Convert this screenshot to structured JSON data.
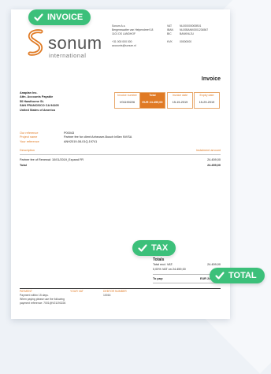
{
  "badges": {
    "invoice": "INVOICE",
    "tax": "TAX",
    "total": "TOTAL"
  },
  "company": {
    "logo_word": "sonum",
    "logo_sub": "international",
    "address_lines": [
      "Sonum A.s.",
      "Bergenswatter van Helpendreef 18",
      "1101 DS LANDHOF",
      "",
      "+31 000 000 000",
      "accounts@sonum.nl"
    ],
    "id_labels": [
      "VAT",
      "IBAN",
      "BIC",
      "",
      "KVK"
    ],
    "id_values": [
      "NL000000000B01",
      "NL00BANK0001234567",
      "BANKNL2U",
      "",
      "00000000"
    ]
  },
  "doc_title": "Invoice",
  "meta": [
    {
      "label": "Invoice number",
      "value": "V01190226"
    },
    {
      "label": "Total",
      "value": "EUR 24.459,00"
    },
    {
      "label": "Invoice date",
      "value": "15-15-2019"
    },
    {
      "label": "Expiry date",
      "value": "15-29-2019"
    }
  ],
  "bill_to": {
    "company": "Anaplan Inc.",
    "lines": [
      "Attn. Accounts Payable",
      "50 Hawthorne St.",
      "SAN FRANCISCO CA 94105",
      "United States of America"
    ]
  },
  "refs": [
    {
      "label": "Our reference",
      "value": "P00043"
    },
    {
      "label": "Project name",
      "value": "Partner fee for client Anheuser-Busch InBev NV/SA"
    },
    {
      "label": "Your reference",
      "value": "ANH2019-08-01Q-19741"
    }
  ],
  "lines_header": {
    "description": "Description",
    "amount": "Instalment amount"
  },
  "lines": [
    {
      "description": "Partner fee of Renewal: 10/01/2019_Expand FR",
      "amount": "24.459,00"
    }
  ],
  "total_row": {
    "label": "Total",
    "amount": "24.459,00"
  },
  "totals": {
    "title": "Totals",
    "excl_label": "Total excl. VAT:",
    "excl_value": "24.459,00",
    "vat_label": "0,00% VAT on 24.459,00",
    "vat_value": "0,00",
    "pay_label": "To pay:",
    "pay_value": "EUR 24.459,00"
  },
  "footer": {
    "payment_head": "PAYMENT",
    "payment_lines": [
      "Payment within 15 days.",
      "When paying please use the following",
      "payment reference: 7001@V01190226"
    ],
    "vat_head": "YOUR VAT",
    "debtor_head": "DEBTOR NUMBER",
    "debtor_value": "10016"
  },
  "colors": {
    "accent": "#e07a24",
    "badge": "#3cc07a"
  }
}
